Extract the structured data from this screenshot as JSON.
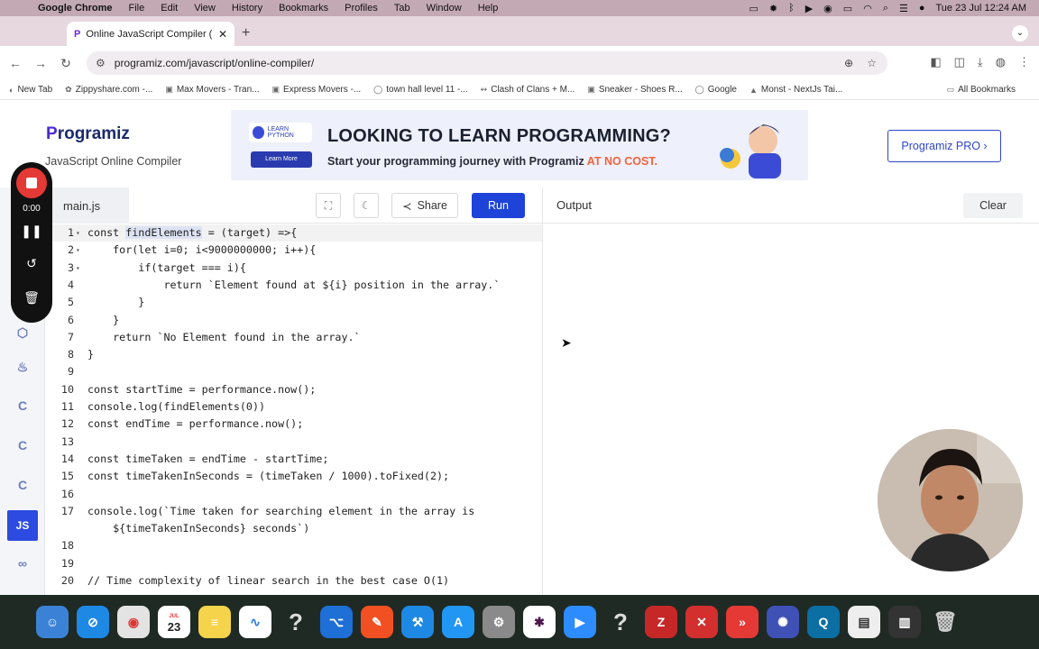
{
  "menubar": {
    "app": "Google Chrome",
    "items": [
      "File",
      "Edit",
      "View",
      "History",
      "Bookmarks",
      "Profiles",
      "Tab",
      "Window",
      "Help"
    ],
    "clock": "Tue 23 Jul  12:24 AM"
  },
  "browser": {
    "tab_title": "Online JavaScript Compiler (E",
    "url": "programiz.com/javascript/online-compiler/",
    "bookmarks": [
      "New Tab",
      "Zippyshare.com -...",
      "Max Movers - Tran...",
      "Express Movers -...",
      "town hall level 11 -...",
      "Clash of Clans + M...",
      "Sneaker - Shoes R...",
      "Google",
      "Monst - NextJs Tai..."
    ],
    "all_bookmarks": "All Bookmarks"
  },
  "header": {
    "logo": "rogramiz",
    "logo_p": "P",
    "subtitle": "JavaScript Online Compiler",
    "ad_badge": "LEARN PYTHON",
    "ad_button": "Learn More",
    "ad_headline": "LOOKING TO LEARN PROGRAMMING?",
    "ad_sub": "Start your programming journey with Programiz ",
    "ad_sub_highlight": "AT NO COST.",
    "pro_button": "Programiz PRO ›"
  },
  "recorder": {
    "time": "0:00"
  },
  "sidebar": {
    "active_label": "JS"
  },
  "editor": {
    "file_tab": "main.js",
    "share_label": "Share",
    "run_label": "Run",
    "lines": [
      {
        "n": "1",
        "fold": "▾",
        "code": "const findElements = (target) =>{"
      },
      {
        "n": "2",
        "fold": "▾",
        "code": "    for(let i=0; i<9000000000; i++){"
      },
      {
        "n": "3",
        "fold": "▾",
        "code": "        if(target === i){"
      },
      {
        "n": "4",
        "fold": "",
        "code": "            return `Element found at ${i} position in the array.`"
      },
      {
        "n": "5",
        "fold": "",
        "code": "        }"
      },
      {
        "n": "6",
        "fold": "",
        "code": "    }"
      },
      {
        "n": "7",
        "fold": "",
        "code": "    return `No Element found in the array.`"
      },
      {
        "n": "8",
        "fold": "",
        "code": "}"
      },
      {
        "n": "9",
        "fold": "",
        "code": ""
      },
      {
        "n": "10",
        "fold": "",
        "code": "const startTime = performance.now();"
      },
      {
        "n": "11",
        "fold": "",
        "code": "console.log(findElements(0))"
      },
      {
        "n": "12",
        "fold": "",
        "code": "const endTime = performance.now();"
      },
      {
        "n": "13",
        "fold": "",
        "code": ""
      },
      {
        "n": "14",
        "fold": "",
        "code": "const timeTaken = endTime - startTime;"
      },
      {
        "n": "15",
        "fold": "",
        "code": "const timeTakenInSeconds = (timeTaken / 1000).toFixed(2);"
      },
      {
        "n": "16",
        "fold": "",
        "code": ""
      },
      {
        "n": "17",
        "fold": "",
        "code": "console.log(`Time taken for searching element in the array is"
      },
      {
        "n": "",
        "fold": "",
        "code": "    ${timeTakenInSeconds} seconds`)"
      },
      {
        "n": "18",
        "fold": "",
        "code": ""
      },
      {
        "n": "19",
        "fold": "",
        "code": ""
      },
      {
        "n": "20",
        "fold": "",
        "code": "// Time complexity of linear search in the best case O(1)"
      }
    ]
  },
  "output": {
    "title": "Output",
    "clear_label": "Clear"
  },
  "dock": {
    "calendar_day": "23",
    "calendar_month": "JUL"
  },
  "colors": {
    "run_button": "#1d43d8",
    "brand": "#4b2bd6",
    "ad_highlight": "#f2633a",
    "recorder_stop": "#e53935"
  }
}
